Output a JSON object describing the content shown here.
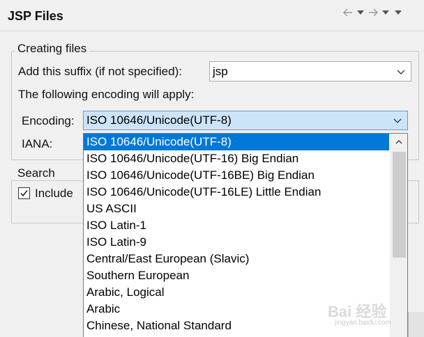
{
  "header": {
    "title": "JSP Files",
    "nav_icons": [
      "back-arrow-icon",
      "back-menu-icon",
      "forward-arrow-icon",
      "forward-menu-icon",
      "view-menu-icon"
    ]
  },
  "creating_files": {
    "legend": "Creating files",
    "suffix_label": "Add this suffix (if not specified):",
    "suffix_value": "jsp",
    "encoding_note": "The following encoding will apply:",
    "encoding_label": "Encoding:",
    "encoding_value": "ISO 10646/Unicode(UTF-8)",
    "iana_label": "IANA:"
  },
  "search": {
    "legend": "Search",
    "include_label": "Include",
    "include_checked": true
  },
  "encoding_dropdown": {
    "selected_index": 0,
    "options": [
      "ISO 10646/Unicode(UTF-8)",
      "ISO 10646/Unicode(UTF-16) Big Endian",
      "ISO 10646/Unicode(UTF-16BE) Big Endian",
      "ISO 10646/Unicode(UTF-16LE) Little Endian",
      "US ASCII",
      "ISO Latin-1",
      "ISO Latin-9",
      "Central/East European (Slavic)",
      "Southern European",
      "Arabic, Logical",
      "Arabic",
      "Chinese, National Standard"
    ]
  },
  "watermark": {
    "text": "Bai 经验",
    "sub": "jingyan.baidu.com"
  },
  "colors": {
    "selection": "#0078d7",
    "combo_focus": "#cce4f7"
  }
}
